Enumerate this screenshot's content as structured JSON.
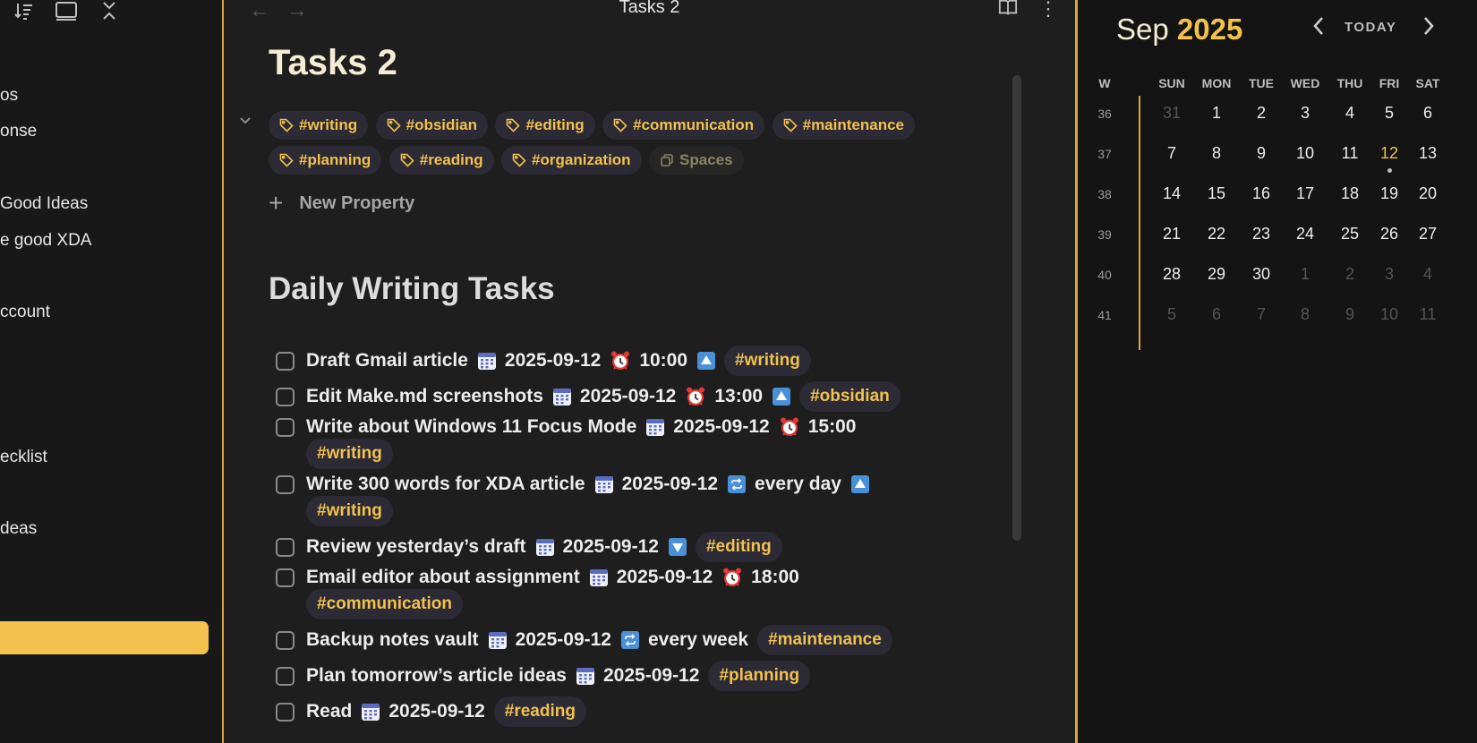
{
  "sidebar": {
    "items": [
      {
        "label": "os"
      },
      {
        "label": "onse"
      },
      {
        "label": "Good Ideas"
      },
      {
        "label": "e good XDA"
      },
      {
        "label": "ccount"
      },
      {
        "label": "ecklist"
      },
      {
        "label": "deas"
      }
    ],
    "toolbar_icons": [
      "sort-icon",
      "layout-icon",
      "collapse-all-icon"
    ]
  },
  "tab": {
    "title": "Tasks 2"
  },
  "note": {
    "title": "Tasks 2",
    "tags": [
      {
        "label": "#writing"
      },
      {
        "label": "#obsidian"
      },
      {
        "label": "#editing"
      },
      {
        "label": "#communication"
      },
      {
        "label": "#maintenance"
      },
      {
        "label": "#planning"
      },
      {
        "label": "#reading"
      },
      {
        "label": "#organization"
      }
    ],
    "spaces_label": "Spaces",
    "new_property_label": "New Property",
    "section_heading": "Daily Writing Tasks",
    "tasks": [
      {
        "text": "Draft Gmail article",
        "date": "2025-09-12",
        "time": "10:00",
        "priority": "up",
        "tag": "#writing"
      },
      {
        "text": "Edit Make.md screenshots",
        "date": "2025-09-12",
        "time": "13:00",
        "priority": "up",
        "tag": "#obsidian"
      },
      {
        "text": "Write about Windows 11 Focus Mode",
        "date": "2025-09-12",
        "time": "15:00",
        "tag": "#writing"
      },
      {
        "text": "Write 300 words for XDA article",
        "date": "2025-09-12",
        "recurrence": "every day",
        "priority": "up",
        "tag": "#writing"
      },
      {
        "text": "Review yesterday’s draft",
        "date": "2025-09-12",
        "priority": "down",
        "tag": "#editing"
      },
      {
        "text": "Email editor about assignment",
        "date": "2025-09-12",
        "time": "18:00",
        "tag": "#communication"
      },
      {
        "text": "Backup notes vault",
        "date": "2025-09-12",
        "recurrence": "every week",
        "tag": "#maintenance"
      },
      {
        "text": "Plan tomorrow’s article ideas",
        "date": "2025-09-12",
        "tag": "#planning"
      },
      {
        "text": "Read",
        "date": "2025-09-12",
        "tag": "#reading"
      }
    ]
  },
  "calendar": {
    "month": "Sep",
    "year": "2025",
    "today_label": "TODAY",
    "week_header": "W",
    "day_headers": [
      "SUN",
      "MON",
      "TUE",
      "WED",
      "THU",
      "FRI",
      "SAT"
    ],
    "weeks": [
      {
        "week": "36",
        "days": [
          "31",
          "1",
          "2",
          "3",
          "4",
          "5",
          "6"
        ]
      },
      {
        "week": "37",
        "days": [
          "7",
          "8",
          "9",
          "10",
          "11",
          "12",
          "13"
        ]
      },
      {
        "week": "38",
        "days": [
          "14",
          "15",
          "16",
          "17",
          "18",
          "19",
          "20"
        ]
      },
      {
        "week": "39",
        "days": [
          "21",
          "22",
          "23",
          "24",
          "25",
          "26",
          "27"
        ]
      },
      {
        "week": "40",
        "days": [
          "28",
          "29",
          "30",
          "1",
          "2",
          "3",
          "4"
        ]
      },
      {
        "week": "41",
        "days": [
          "5",
          "6",
          "7",
          "8",
          "9",
          "10",
          "11"
        ]
      }
    ],
    "today": "12",
    "accent_color": "#f2c14e"
  }
}
